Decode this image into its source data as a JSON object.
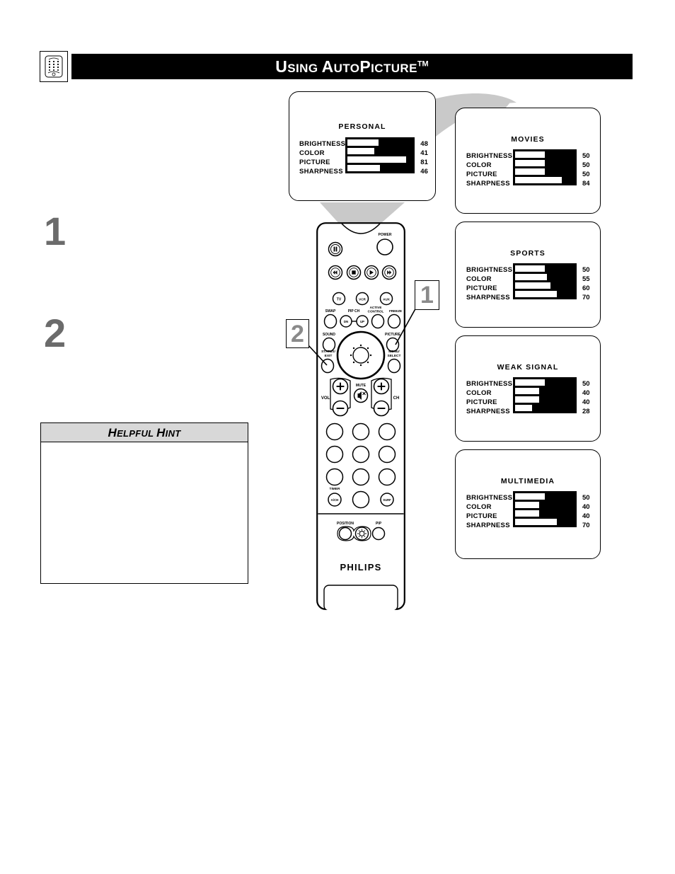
{
  "header": {
    "icon": "remote-control-icon",
    "title_parts": {
      "u": "U",
      "sing": "SING ",
      "a": "A",
      "uto": "UTO",
      "p": "P",
      "icture": "ICTURE",
      "tm": "TM"
    },
    "title_plain": "USING AUTOPICTURE TM"
  },
  "steps": [
    {
      "number": "1",
      "text": ""
    },
    {
      "number": "2",
      "text": ""
    }
  ],
  "hint": {
    "title_parts": {
      "h1": "H",
      "elpful": "ELPFUL ",
      "h2": "H",
      "int": "INT"
    },
    "title_plain": "HELPFUL HINT",
    "body": ""
  },
  "callouts": [
    {
      "id": "callout-1",
      "label": "1",
      "points_to": "picture-button"
    },
    {
      "id": "callout-2",
      "label": "2",
      "points_to": "status-exit-button"
    }
  ],
  "osd_labels": [
    "BRIGHTNESS",
    "COLOR",
    "PICTURE",
    "SHARPNESS"
  ],
  "panels": [
    {
      "id": "personal",
      "title": "PERSONAL",
      "rows": [
        {
          "label": "BRIGHTNESS",
          "value": "48",
          "fill_pct": 52
        },
        {
          "label": "COLOR",
          "value": "41",
          "fill_pct": 59
        },
        {
          "label": "PICTURE",
          "value": "81",
          "fill_pct": 10
        },
        {
          "label": "SHARPNESS",
          "value": "46",
          "fill_pct": 50
        }
      ]
    },
    {
      "id": "movies",
      "title": "MOVIES",
      "rows": [
        {
          "label": "BRIGHTNESS",
          "value": "50",
          "fill_pct": 50
        },
        {
          "label": "COLOR",
          "value": "50",
          "fill_pct": 50
        },
        {
          "label": "PICTURE",
          "value": "50",
          "fill_pct": 50
        },
        {
          "label": "SHARPNESS",
          "value": "84",
          "fill_pct": 22
        }
      ]
    },
    {
      "id": "sports",
      "title": "SPORTS",
      "rows": [
        {
          "label": "BRIGHTNESS",
          "value": "50",
          "fill_pct": 50
        },
        {
          "label": "COLOR",
          "value": "55",
          "fill_pct": 46
        },
        {
          "label": "PICTURE",
          "value": "60",
          "fill_pct": 40
        },
        {
          "label": "SHARPNESS",
          "value": "70",
          "fill_pct": 30
        }
      ]
    },
    {
      "id": "weak",
      "title": "WEAK SIGNAL",
      "rows": [
        {
          "label": "BRIGHTNESS",
          "value": "50",
          "fill_pct": 50
        },
        {
          "label": "COLOR",
          "value": "40",
          "fill_pct": 60
        },
        {
          "label": "PICTURE",
          "value": "40",
          "fill_pct": 60
        },
        {
          "label": "SHARPNESS",
          "value": "28",
          "fill_pct": 72
        }
      ]
    },
    {
      "id": "multimedia",
      "title": "MULTIMEDIA",
      "rows": [
        {
          "label": "BRIGHTNESS",
          "value": "50",
          "fill_pct": 50
        },
        {
          "label": "COLOR",
          "value": "40",
          "fill_pct": 60
        },
        {
          "label": "PICTURE",
          "value": "40",
          "fill_pct": 60
        },
        {
          "label": "SHARPNESS",
          "value": "70",
          "fill_pct": 30
        }
      ]
    }
  ],
  "remote": {
    "brand": "PHILIPS",
    "buttons": {
      "power": "POWER",
      "tv": "TV",
      "vcr": "VCR",
      "aux": "AUX",
      "swap": "SWAP",
      "pip_ch": "PIP CH",
      "pip_dn": "DN",
      "pip_up": "UP",
      "active_control_line1": "ACTIVE",
      "active_control_line2": "CONTROL",
      "freeze": "FREEZE",
      "sound": "SOUND",
      "picture": "PICTURE",
      "status_line1": "STATUS/",
      "status_line2": "EXIT",
      "menu_line1": "MENU/",
      "menu_line2": "SELECT",
      "vol": "VOL",
      "ch": "CH",
      "mute": "MUTE",
      "timer": "TIMER",
      "a_ch": "A/CH",
      "surf": "SURF",
      "position": "POSITION",
      "pip": "PIP"
    }
  },
  "colors": {
    "ink": "#000000",
    "gray_number": "#6b6b6b",
    "callout_number": "#8a8a8a",
    "hint_header": "#d8d8d8",
    "flow_gray": "#c9c9c9"
  }
}
